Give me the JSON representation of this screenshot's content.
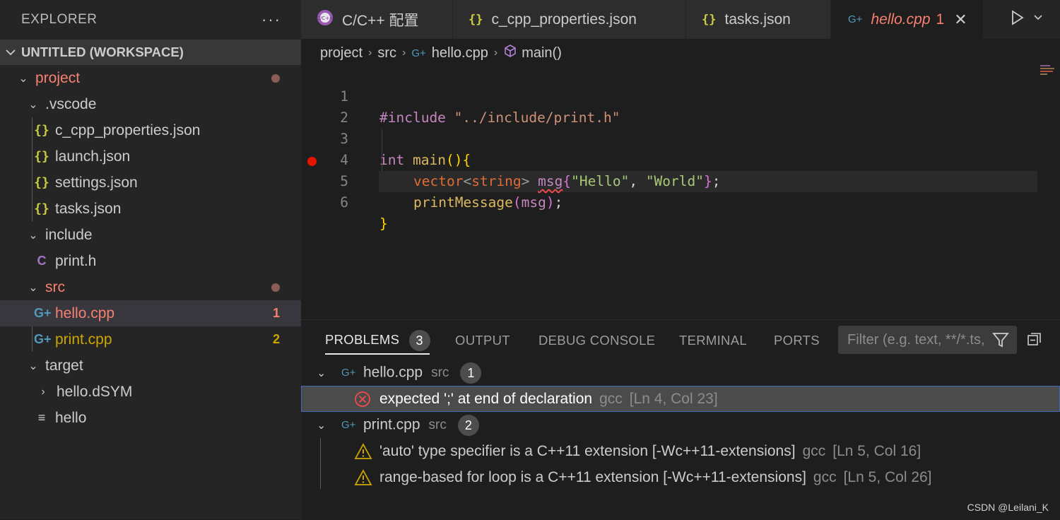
{
  "sidebar": {
    "title": "EXPLORER",
    "more": "···",
    "workspace": "UNTITLED (WORKSPACE)",
    "tree": [
      {
        "label": "project",
        "kind": "folder",
        "color": "#f88070"
      },
      {
        "label": ".vscode",
        "kind": "folder",
        "color": "#cccccc"
      },
      {
        "label": "c_cpp_properties.json",
        "kind": "json",
        "color": "#cccccc"
      },
      {
        "label": "launch.json",
        "kind": "json",
        "color": "#cccccc"
      },
      {
        "label": "settings.json",
        "kind": "json",
        "color": "#cccccc"
      },
      {
        "label": "tasks.json",
        "kind": "json",
        "color": "#cccccc"
      },
      {
        "label": "include",
        "kind": "folder",
        "color": "#cccccc"
      },
      {
        "label": "print.h",
        "kind": "c",
        "color": "#cccccc"
      },
      {
        "label": "src",
        "kind": "folder",
        "color": "#f88070"
      },
      {
        "label": "hello.cpp",
        "kind": "cpp",
        "color": "#f88070",
        "badge": "1"
      },
      {
        "label": "print.cpp",
        "kind": "cpp",
        "color": "#cca700",
        "badge": "2"
      },
      {
        "label": "target",
        "kind": "folder",
        "color": "#cccccc"
      },
      {
        "label": "hello.dSYM",
        "kind": "folder-collapsed",
        "color": "#cccccc"
      },
      {
        "label": "hello",
        "kind": "text",
        "color": "#cccccc"
      }
    ]
  },
  "tabs": [
    {
      "label": "C/C++ 配置",
      "icon": "cpp-config-icon"
    },
    {
      "label": "c_cpp_properties.json",
      "icon": "json-icon"
    },
    {
      "label": "tasks.json",
      "icon": "json-icon"
    },
    {
      "label": "hello.cpp",
      "badge": "1",
      "icon": "cpp-icon"
    }
  ],
  "breadcrumb": {
    "items": [
      "project",
      "src",
      "hello.cpp",
      "main()"
    ]
  },
  "editor": {
    "line_numbers": [
      "1",
      "2",
      "3",
      "4",
      "5",
      "6"
    ],
    "code": {
      "l1_kw": "#include",
      "l1_str": "\"../include/print.h\"",
      "l3_type": "int",
      "l3_fn": "main",
      "l3_paren": "()",
      "l3_brace": "{",
      "l4_type": "vector",
      "l4_lt": "<",
      "l4_tparam": "string",
      "l4_gt": ">",
      "l4_var": "msg",
      "l4_ob": "{",
      "l4_s1": "\"Hello\"",
      "l4_comma": ", ",
      "l4_s2": "\"World\"",
      "l4_cb": "}",
      "l4_semi": ";",
      "l5_fn": "printMessage",
      "l5_op": "(",
      "l5_var": "msg",
      "l5_cp": ")",
      "l5_semi": ";",
      "l6_brace": "}"
    }
  },
  "panel": {
    "tabs": [
      "PROBLEMS",
      "OUTPUT",
      "DEBUG CONSOLE",
      "TERMINAL",
      "PORTS"
    ],
    "problems_count": "3",
    "filter_placeholder": "Filter (e.g. text, **/*.ts, !**/node_modules/**)",
    "groups": [
      {
        "file": "hello.cpp",
        "dir": "src",
        "count": "1",
        "issues": [
          {
            "severity": "error",
            "message": "expected ';' at end of declaration",
            "source": "gcc",
            "location": "[Ln 4, Col 23]"
          }
        ]
      },
      {
        "file": "print.cpp",
        "dir": "src",
        "count": "2",
        "issues": [
          {
            "severity": "warning",
            "message": "'auto' type specifier is a C++11 extension [-Wc++11-extensions]",
            "source": "gcc",
            "location": "[Ln 5, Col 16]"
          },
          {
            "severity": "warning",
            "message": "range-based for loop is a C++11 extension [-Wc++11-extensions]",
            "source": "gcc",
            "location": "[Ln 5, Col 26]"
          }
        ]
      }
    ]
  },
  "watermark": "CSDN @Leilani_K",
  "colors": {
    "error": "#f14c4c",
    "warning": "#cca700",
    "modified": "#f88070",
    "breakpoint": "#e51400"
  }
}
